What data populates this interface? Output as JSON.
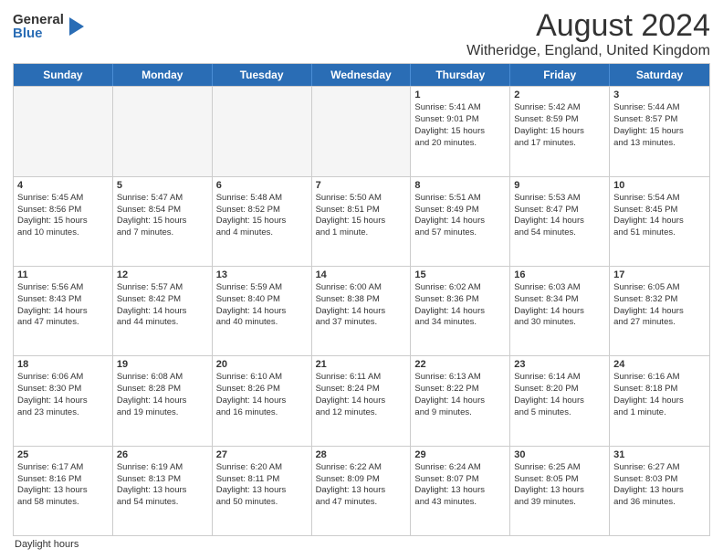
{
  "logo": {
    "general": "General",
    "blue": "Blue"
  },
  "title": "August 2024",
  "subtitle": "Witheridge, England, United Kingdom",
  "days": [
    "Sunday",
    "Monday",
    "Tuesday",
    "Wednesday",
    "Thursday",
    "Friday",
    "Saturday"
  ],
  "footer": "Daylight hours",
  "weeks": [
    [
      {
        "num": "",
        "lines": [],
        "empty": true
      },
      {
        "num": "",
        "lines": [],
        "empty": true
      },
      {
        "num": "",
        "lines": [],
        "empty": true
      },
      {
        "num": "",
        "lines": [],
        "empty": true
      },
      {
        "num": "1",
        "lines": [
          "Sunrise: 5:41 AM",
          "Sunset: 9:01 PM",
          "Daylight: 15 hours",
          "and 20 minutes."
        ]
      },
      {
        "num": "2",
        "lines": [
          "Sunrise: 5:42 AM",
          "Sunset: 8:59 PM",
          "Daylight: 15 hours",
          "and 17 minutes."
        ]
      },
      {
        "num": "3",
        "lines": [
          "Sunrise: 5:44 AM",
          "Sunset: 8:57 PM",
          "Daylight: 15 hours",
          "and 13 minutes."
        ]
      }
    ],
    [
      {
        "num": "4",
        "lines": [
          "Sunrise: 5:45 AM",
          "Sunset: 8:56 PM",
          "Daylight: 15 hours",
          "and 10 minutes."
        ]
      },
      {
        "num": "5",
        "lines": [
          "Sunrise: 5:47 AM",
          "Sunset: 8:54 PM",
          "Daylight: 15 hours",
          "and 7 minutes."
        ]
      },
      {
        "num": "6",
        "lines": [
          "Sunrise: 5:48 AM",
          "Sunset: 8:52 PM",
          "Daylight: 15 hours",
          "and 4 minutes."
        ]
      },
      {
        "num": "7",
        "lines": [
          "Sunrise: 5:50 AM",
          "Sunset: 8:51 PM",
          "Daylight: 15 hours",
          "and 1 minute."
        ]
      },
      {
        "num": "8",
        "lines": [
          "Sunrise: 5:51 AM",
          "Sunset: 8:49 PM",
          "Daylight: 14 hours",
          "and 57 minutes."
        ]
      },
      {
        "num": "9",
        "lines": [
          "Sunrise: 5:53 AM",
          "Sunset: 8:47 PM",
          "Daylight: 14 hours",
          "and 54 minutes."
        ]
      },
      {
        "num": "10",
        "lines": [
          "Sunrise: 5:54 AM",
          "Sunset: 8:45 PM",
          "Daylight: 14 hours",
          "and 51 minutes."
        ]
      }
    ],
    [
      {
        "num": "11",
        "lines": [
          "Sunrise: 5:56 AM",
          "Sunset: 8:43 PM",
          "Daylight: 14 hours",
          "and 47 minutes."
        ]
      },
      {
        "num": "12",
        "lines": [
          "Sunrise: 5:57 AM",
          "Sunset: 8:42 PM",
          "Daylight: 14 hours",
          "and 44 minutes."
        ]
      },
      {
        "num": "13",
        "lines": [
          "Sunrise: 5:59 AM",
          "Sunset: 8:40 PM",
          "Daylight: 14 hours",
          "and 40 minutes."
        ]
      },
      {
        "num": "14",
        "lines": [
          "Sunrise: 6:00 AM",
          "Sunset: 8:38 PM",
          "Daylight: 14 hours",
          "and 37 minutes."
        ]
      },
      {
        "num": "15",
        "lines": [
          "Sunrise: 6:02 AM",
          "Sunset: 8:36 PM",
          "Daylight: 14 hours",
          "and 34 minutes."
        ]
      },
      {
        "num": "16",
        "lines": [
          "Sunrise: 6:03 AM",
          "Sunset: 8:34 PM",
          "Daylight: 14 hours",
          "and 30 minutes."
        ]
      },
      {
        "num": "17",
        "lines": [
          "Sunrise: 6:05 AM",
          "Sunset: 8:32 PM",
          "Daylight: 14 hours",
          "and 27 minutes."
        ]
      }
    ],
    [
      {
        "num": "18",
        "lines": [
          "Sunrise: 6:06 AM",
          "Sunset: 8:30 PM",
          "Daylight: 14 hours",
          "and 23 minutes."
        ]
      },
      {
        "num": "19",
        "lines": [
          "Sunrise: 6:08 AM",
          "Sunset: 8:28 PM",
          "Daylight: 14 hours",
          "and 19 minutes."
        ]
      },
      {
        "num": "20",
        "lines": [
          "Sunrise: 6:10 AM",
          "Sunset: 8:26 PM",
          "Daylight: 14 hours",
          "and 16 minutes."
        ]
      },
      {
        "num": "21",
        "lines": [
          "Sunrise: 6:11 AM",
          "Sunset: 8:24 PM",
          "Daylight: 14 hours",
          "and 12 minutes."
        ]
      },
      {
        "num": "22",
        "lines": [
          "Sunrise: 6:13 AM",
          "Sunset: 8:22 PM",
          "Daylight: 14 hours",
          "and 9 minutes."
        ]
      },
      {
        "num": "23",
        "lines": [
          "Sunrise: 6:14 AM",
          "Sunset: 8:20 PM",
          "Daylight: 14 hours",
          "and 5 minutes."
        ]
      },
      {
        "num": "24",
        "lines": [
          "Sunrise: 6:16 AM",
          "Sunset: 8:18 PM",
          "Daylight: 14 hours",
          "and 1 minute."
        ]
      }
    ],
    [
      {
        "num": "25",
        "lines": [
          "Sunrise: 6:17 AM",
          "Sunset: 8:16 PM",
          "Daylight: 13 hours",
          "and 58 minutes."
        ]
      },
      {
        "num": "26",
        "lines": [
          "Sunrise: 6:19 AM",
          "Sunset: 8:13 PM",
          "Daylight: 13 hours",
          "and 54 minutes."
        ]
      },
      {
        "num": "27",
        "lines": [
          "Sunrise: 6:20 AM",
          "Sunset: 8:11 PM",
          "Daylight: 13 hours",
          "and 50 minutes."
        ]
      },
      {
        "num": "28",
        "lines": [
          "Sunrise: 6:22 AM",
          "Sunset: 8:09 PM",
          "Daylight: 13 hours",
          "and 47 minutes."
        ]
      },
      {
        "num": "29",
        "lines": [
          "Sunrise: 6:24 AM",
          "Sunset: 8:07 PM",
          "Daylight: 13 hours",
          "and 43 minutes."
        ]
      },
      {
        "num": "30",
        "lines": [
          "Sunrise: 6:25 AM",
          "Sunset: 8:05 PM",
          "Daylight: 13 hours",
          "and 39 minutes."
        ]
      },
      {
        "num": "31",
        "lines": [
          "Sunrise: 6:27 AM",
          "Sunset: 8:03 PM",
          "Daylight: 13 hours",
          "and 36 minutes."
        ]
      }
    ]
  ]
}
